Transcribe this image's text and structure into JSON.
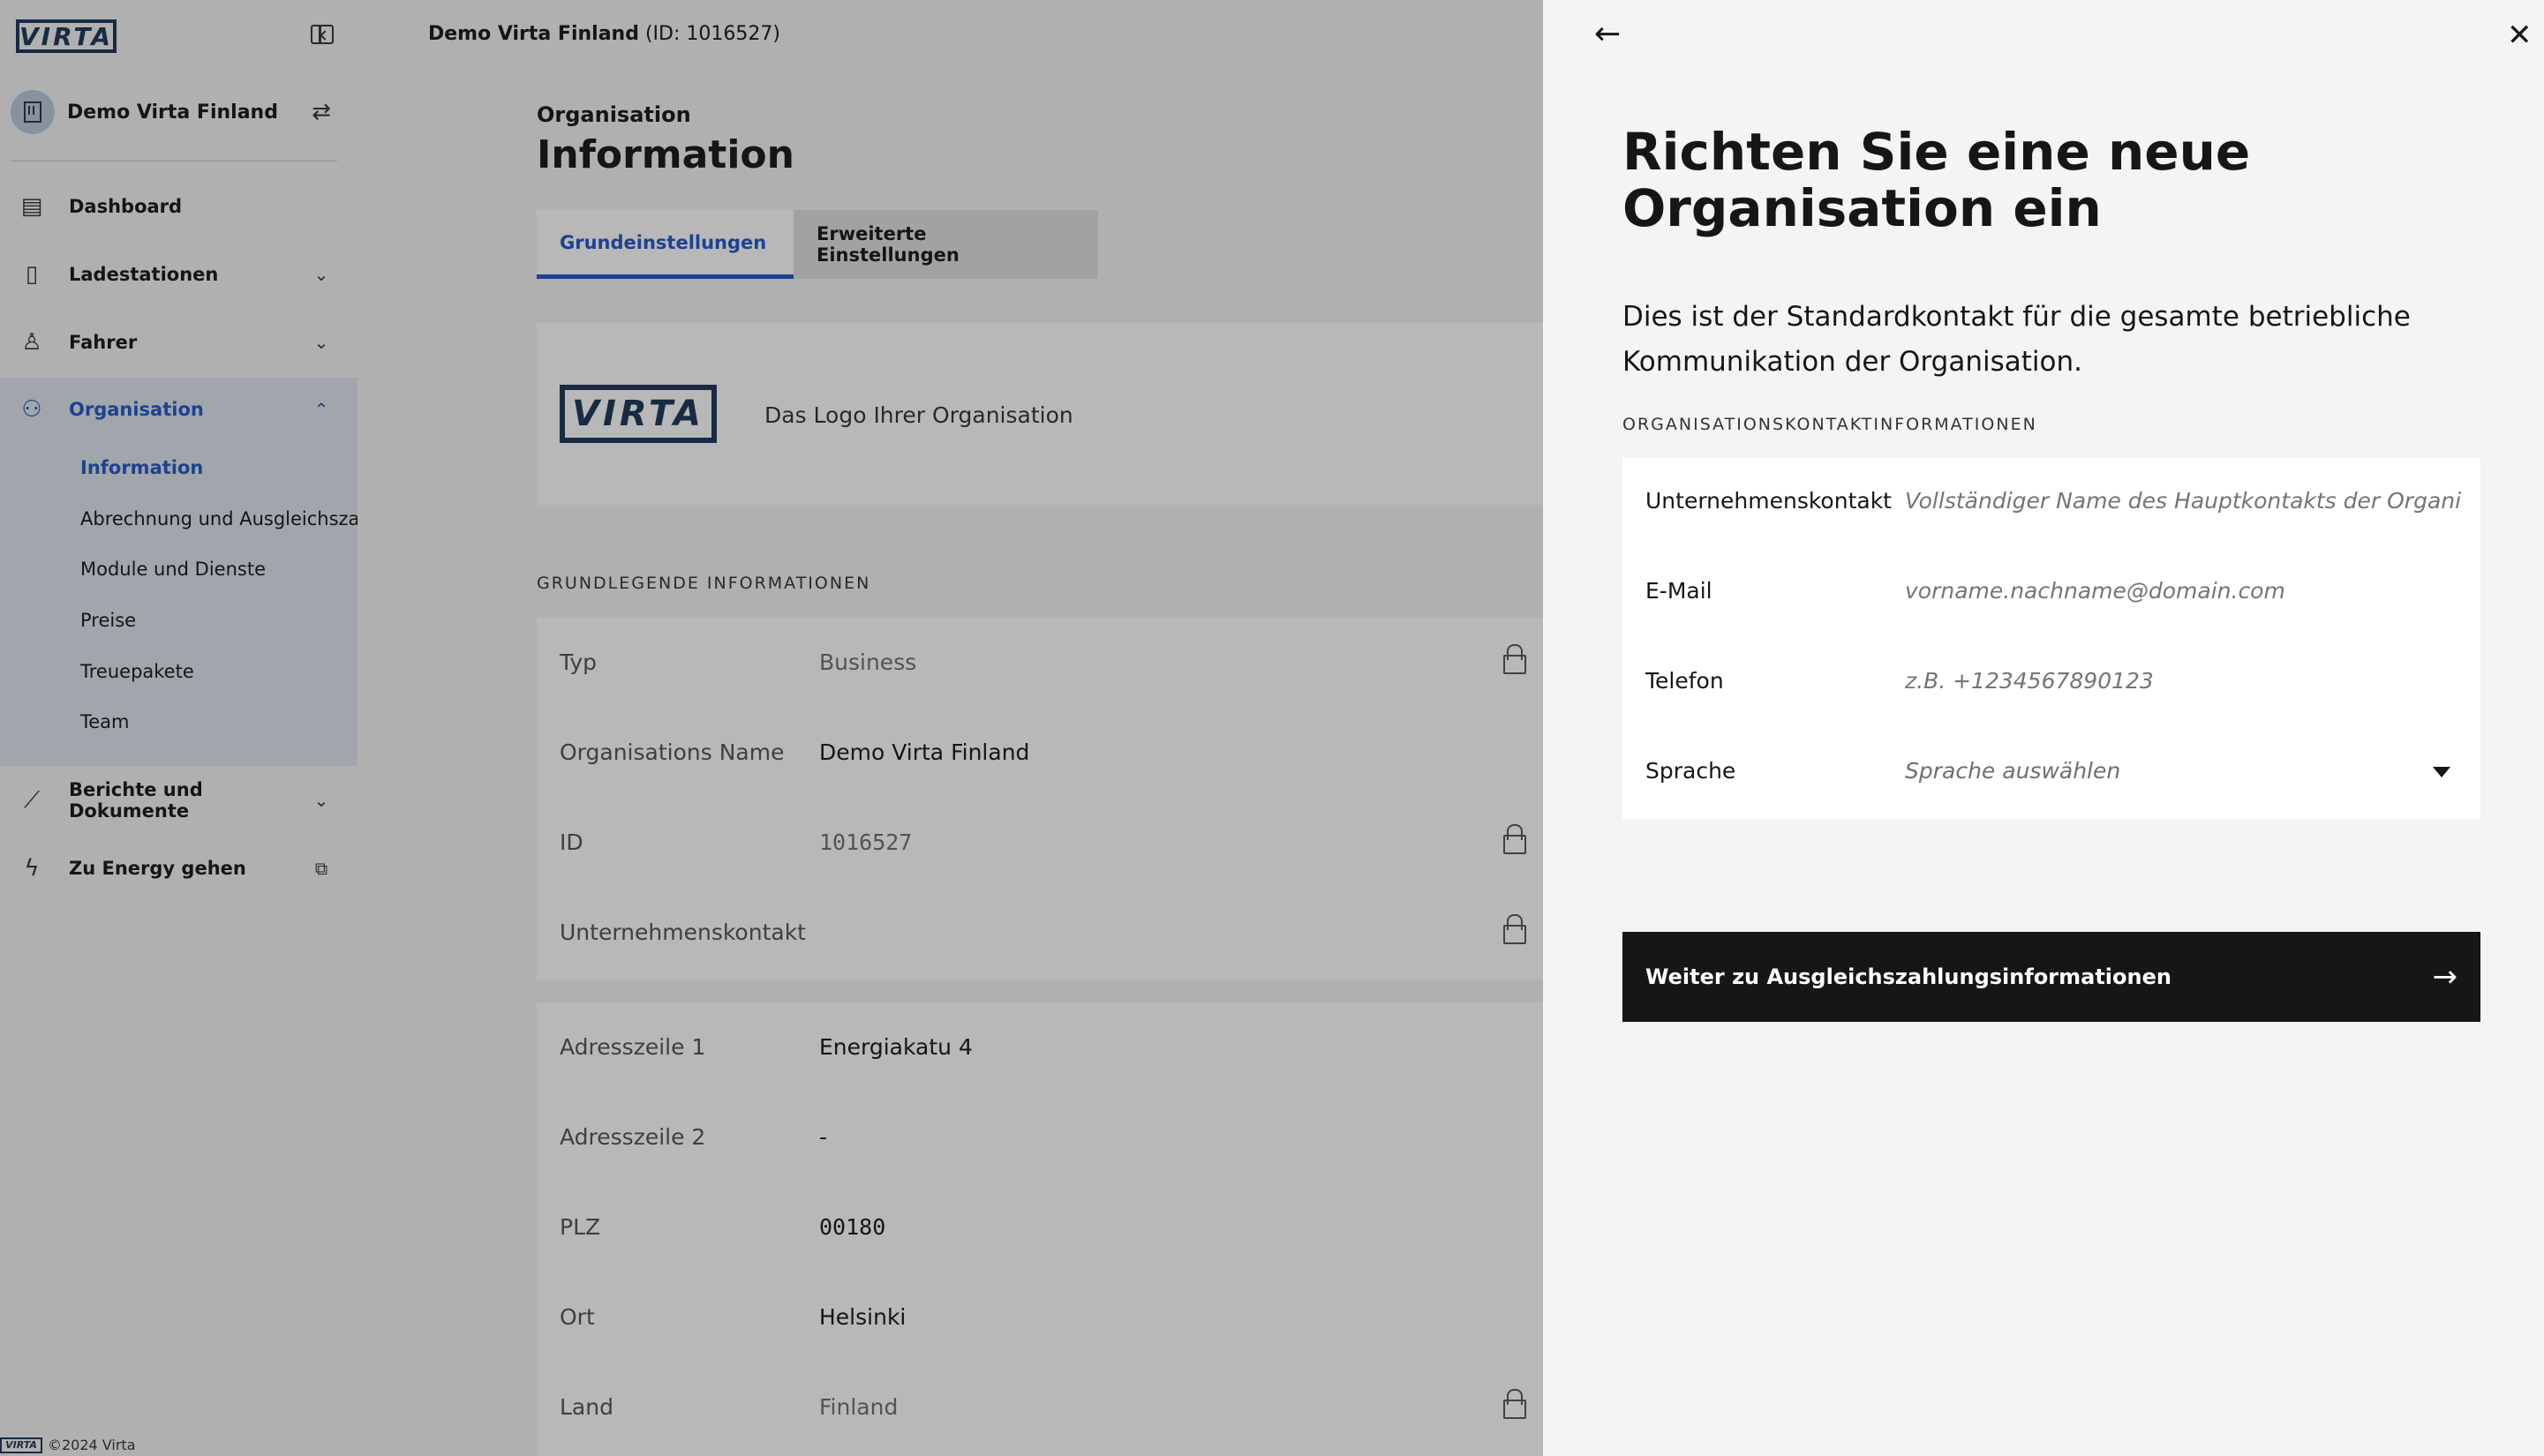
{
  "sidebar": {
    "logo": "VIRTA",
    "org_name": "Demo Virta Finland",
    "nav": [
      {
        "label": "Dashboard",
        "icon": "dashboard-icon"
      },
      {
        "label": "Ladestationen",
        "icon": "charger-icon"
      },
      {
        "label": "Fahrer",
        "icon": "driver-icon"
      },
      {
        "label": "Organisation",
        "icon": "organisation-icon"
      },
      {
        "label": "Berichte und Dokumente",
        "icon": "chart-icon"
      },
      {
        "label": "Zu Energy gehen",
        "icon": "bolt-icon"
      }
    ],
    "subnav": [
      "Information",
      "Abrechnung und Ausgleichszah",
      "Module und Dienste",
      "Preise",
      "Treuepakete",
      "Team"
    ],
    "footer": "©2024 Virta"
  },
  "main": {
    "breadcrumb_name": "Demo Virta Finland",
    "breadcrumb_id": " (ID: 1016527)",
    "section_sub": "Organisation",
    "section_title": "Information",
    "tabs": [
      "Grundeinstellungen",
      "Erweiterte Einstellungen"
    ],
    "logo_text": "Das Logo Ihrer Organisation",
    "basic_header": "GRUNDLEGENDE INFORMATIONEN",
    "basic": [
      {
        "k": "Typ",
        "v": "Business"
      },
      {
        "k": "Organisations Name",
        "v": "Demo Virta Finland"
      },
      {
        "k": "ID",
        "v": "1016527"
      },
      {
        "k": "Unternehmenskontakt",
        "v": ""
      }
    ],
    "address": [
      {
        "k": "Adresszeile 1",
        "v": "Energiakatu 4"
      },
      {
        "k": "Adresszeile 2",
        "v": "-"
      },
      {
        "k": "PLZ",
        "v": "00180"
      },
      {
        "k": "Ort",
        "v": "Helsinki"
      },
      {
        "k": "Land",
        "v": "Finland"
      }
    ]
  },
  "panel": {
    "title": "Richten Sie eine neue Organisation ein",
    "desc": "Dies ist der Standardkontakt für die gesamte betriebliche Kommunikation der Organisation.",
    "section_header": "ORGANISATIONSKONTAKTINFORMATIONEN",
    "fields": [
      {
        "label": "Unternehmenskontakt",
        "placeholder": "Vollständiger Name des Hauptkontakts der Organisation"
      },
      {
        "label": "E-Mail",
        "placeholder": "vorname.nachname@domain.com"
      },
      {
        "label": "Telefon",
        "placeholder": "z.B. +1234567890123"
      },
      {
        "label": "Sprache",
        "placeholder": "Sprache auswählen"
      }
    ],
    "button_label": "Weiter zu Ausgleichszahlungsinformationen"
  },
  "colors": {
    "accent": "#2356c8",
    "brand": "#1c3557",
    "button": "#161616"
  }
}
